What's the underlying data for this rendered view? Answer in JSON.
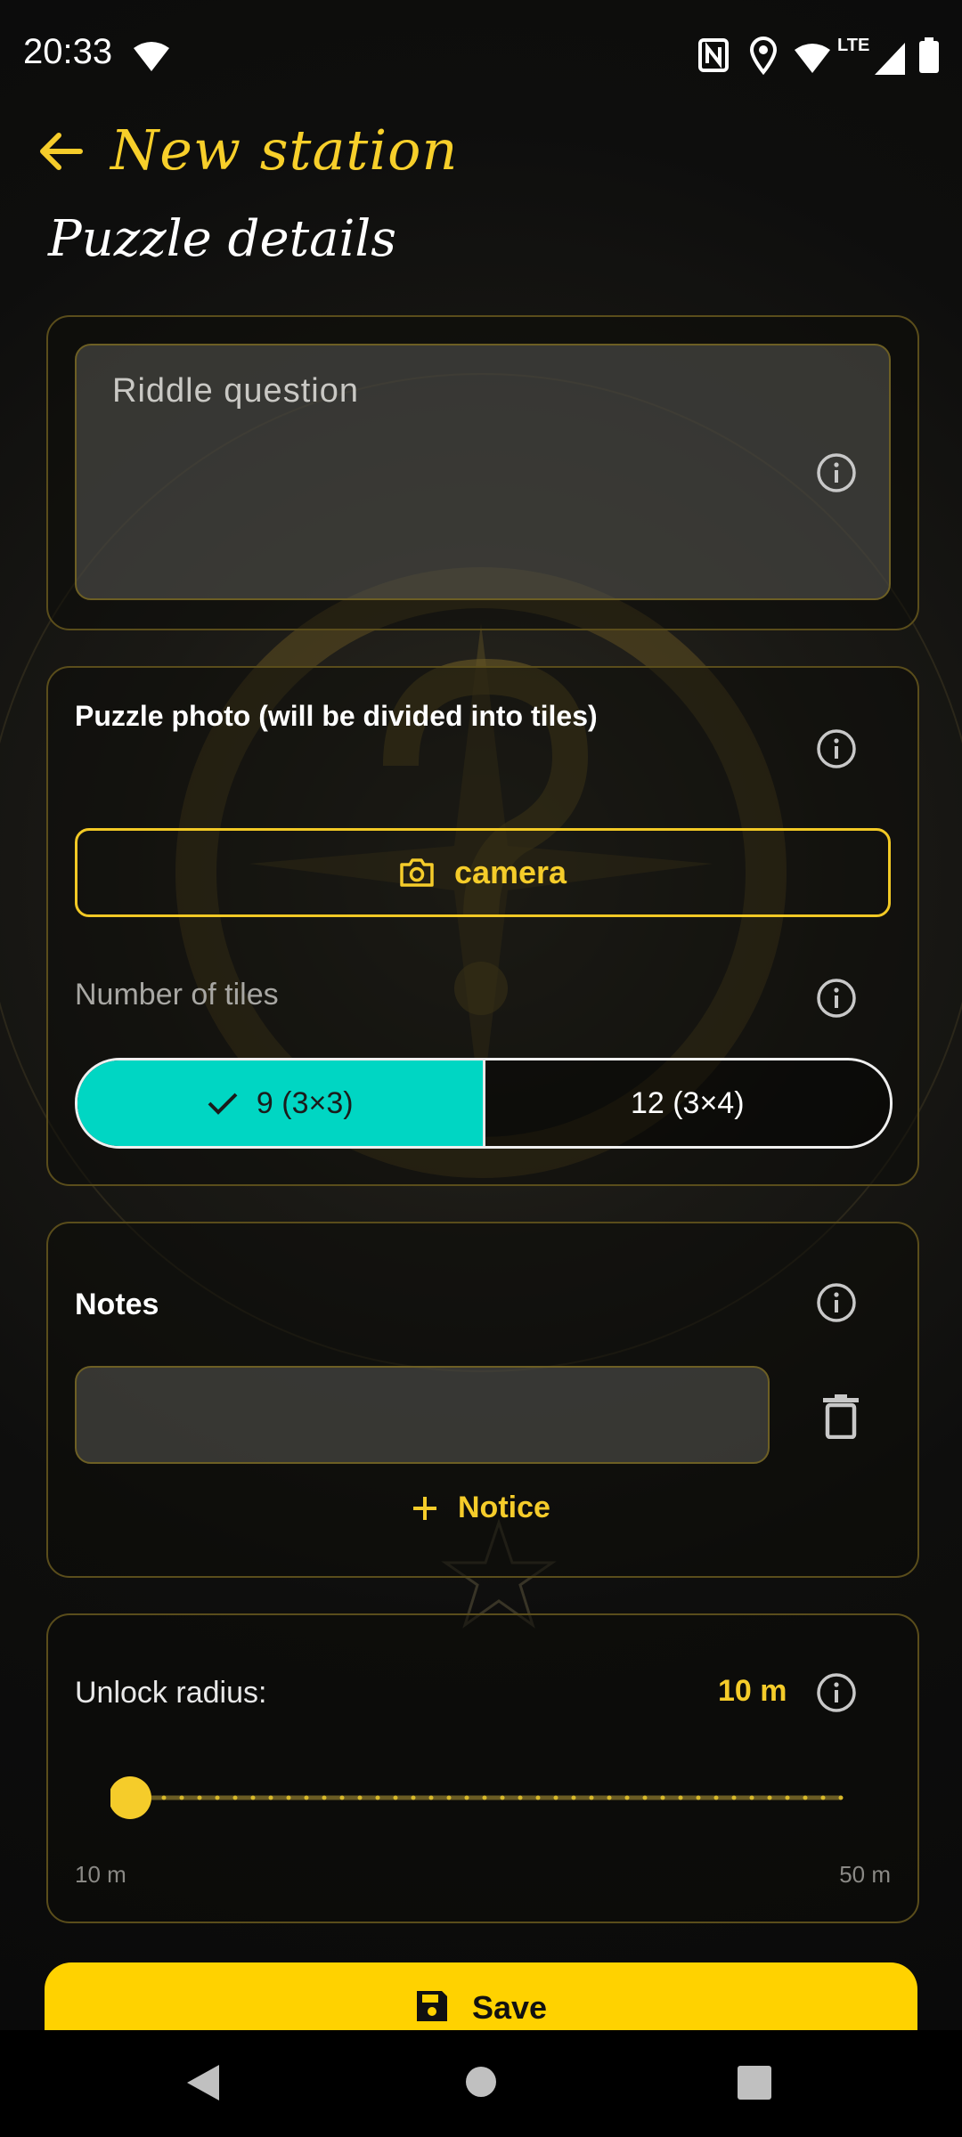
{
  "status_bar": {
    "time": "20:33",
    "network": "LTE"
  },
  "app_bar": {
    "title": "New station"
  },
  "section": {
    "title": "Puzzle details"
  },
  "riddle": {
    "placeholder": "Riddle question"
  },
  "photo": {
    "label": "Puzzle photo (will be divided into tiles)",
    "camera_label": "camera",
    "tiles_label": "Number of tiles",
    "options": [
      {
        "label": "9 (3×3)",
        "selected": true
      },
      {
        "label": "12 (3×4)",
        "selected": false
      }
    ]
  },
  "notes": {
    "label": "Notes",
    "value": "",
    "add_label": "Notice"
  },
  "unlock": {
    "label": "Unlock radius:",
    "value": "10 m",
    "min_label": "10 m",
    "max_label": "50 m",
    "level": 0
  },
  "save_label": "Save",
  "colors": {
    "accent": "#f5cc2a",
    "selected": "#00d6c3",
    "border": "#5a4d1b"
  }
}
